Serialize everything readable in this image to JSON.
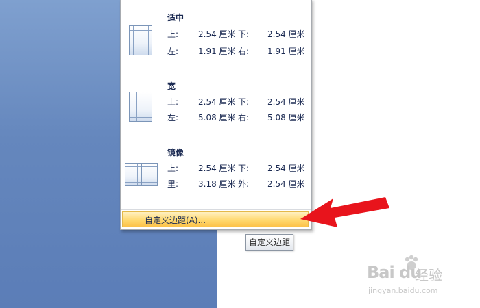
{
  "margins_menu": {
    "presets": [
      {
        "name": "适中",
        "rows": [
          [
            "上:",
            "2.54 厘米",
            "下:",
            "2.54 厘米"
          ],
          [
            "左:",
            "1.91 厘米",
            "右:",
            "1.91 厘米"
          ]
        ]
      },
      {
        "name": "宽",
        "rows": [
          [
            "上:",
            "2.54 厘米",
            "下:",
            "2.54 厘米"
          ],
          [
            "左:",
            "5.08 厘米",
            "右:",
            "5.08 厘米"
          ]
        ]
      },
      {
        "name": "镜像",
        "rows": [
          [
            "上:",
            "2.54 厘米",
            "下:",
            "2.54 厘米"
          ],
          [
            "里:",
            "3.18 厘米",
            "外:",
            "2.54 厘米"
          ]
        ]
      }
    ],
    "custom": {
      "label_prefix": "自定义边距(",
      "label_key": "A",
      "label_suffix": ")..."
    }
  },
  "tooltip": {
    "text": "自定义边距"
  },
  "watermark": {
    "logo": "Bai du",
    "text": "经验",
    "url": "jingyan.baidu.com"
  },
  "colors": {
    "menu_text": "#1b2a52",
    "highlight": "#ffd970",
    "arrow": "#e8141c"
  }
}
